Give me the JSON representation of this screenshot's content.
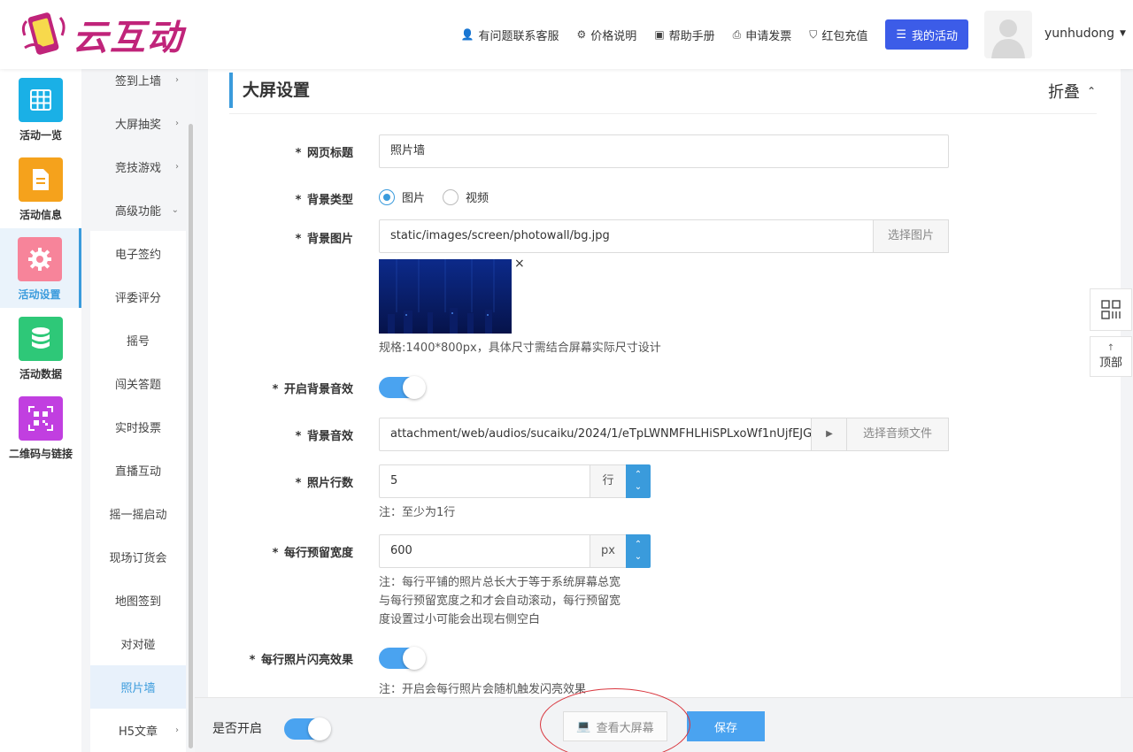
{
  "brand": {
    "logo_text": "云互动"
  },
  "topnav": {
    "items": [
      {
        "label": "有问题联系客服",
        "icon": "user-plus-icon"
      },
      {
        "label": "价格说明",
        "icon": "gear-icon"
      },
      {
        "label": "帮助手册",
        "icon": "book-icon"
      },
      {
        "label": "申请发票",
        "icon": "printer-icon"
      },
      {
        "label": "红包充值",
        "icon": "shield-check-icon"
      }
    ],
    "my_activity": "我的活动",
    "username": "yunhudong"
  },
  "iconbar": {
    "items": [
      {
        "label": "活动一览",
        "color": "#1ab0e6",
        "icon": "grid-icon"
      },
      {
        "label": "活动信息",
        "color": "#f5a21c",
        "icon": "document-icon"
      },
      {
        "label": "活动设置",
        "color": "#f7849a",
        "icon": "gear-icon",
        "active": true
      },
      {
        "label": "活动数据",
        "color": "#2ec878",
        "icon": "database-icon"
      },
      {
        "label": "二维码与链接",
        "color": "#c13fe0",
        "icon": "qrcode-icon"
      }
    ]
  },
  "submenu": {
    "items": [
      {
        "label": "签到上墙",
        "arrow": "›"
      },
      {
        "label": "大屏抽奖",
        "arrow": "›"
      },
      {
        "label": "竞技游戏",
        "arrow": "›"
      },
      {
        "label": "高级功能",
        "arrow": "⌄"
      },
      {
        "label": "电子签约"
      },
      {
        "label": "评委评分"
      },
      {
        "label": "摇号"
      },
      {
        "label": "闯关答题"
      },
      {
        "label": "实时投票"
      },
      {
        "label": "直播互动"
      },
      {
        "label": "摇一摇启动"
      },
      {
        "label": "现场订货会"
      },
      {
        "label": "地图签到"
      },
      {
        "label": "对对碰"
      },
      {
        "label": "照片墙",
        "active": true
      },
      {
        "label": "H5文章",
        "arrow": "›"
      }
    ]
  },
  "section": {
    "title": "大屏设置",
    "fold_label": "折叠"
  },
  "form": {
    "page_title": {
      "label": "网页标题",
      "value": "照片墙"
    },
    "bg_type": {
      "label": "背景类型",
      "opt_image": "图片",
      "opt_video": "视频",
      "selected": "图片"
    },
    "bg_image": {
      "label": "背景图片",
      "value": "static/images/screen/photowall/bg.jpg",
      "button": "选择图片",
      "delete": "×",
      "spec": "规格:1400*800px，具体尺寸需结合屏幕实际尺寸设计"
    },
    "bg_music_on": {
      "label": "开启背景音效",
      "on": true
    },
    "bg_music": {
      "label": "背景音效",
      "value": "attachment/web/audios/sucaiku/2024/1/eTpLWNMFHLHiSPLxoWf1nUjfEJG",
      "play": "▶",
      "button": "选择音频文件"
    },
    "rows": {
      "label": "照片行数",
      "value": "5",
      "unit": "行",
      "note": "注：至少为1行"
    },
    "row_width": {
      "label": "每行预留宽度",
      "value": "600",
      "unit": "px",
      "note_lines": [
        "注：每行平铺的照片总长大于等于系统屏幕总宽",
        "与每行预留宽度之和才会自动滚动，每行预留宽",
        "度设置过小可能会出现右侧空白"
      ]
    },
    "flash": {
      "label": "每行照片闪亮效果",
      "on": true,
      "note": "注：开启会每行照片会随机触发闪亮效果"
    }
  },
  "float_tools": {
    "top_label": "顶部",
    "top_arrow": "↑"
  },
  "bottombar": {
    "enable_label": "是否开启",
    "view_button": "查看大屏幕",
    "save_button": "保存"
  },
  "colors": {
    "accent": "#3a9bdc",
    "brand": "#c0247a",
    "primary_button": "#3c5ce8",
    "annotation": "#d9363e"
  }
}
